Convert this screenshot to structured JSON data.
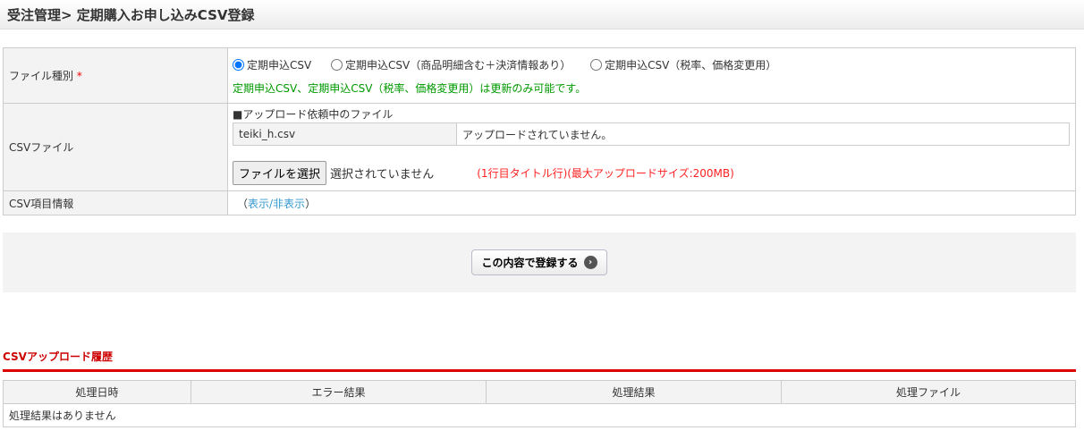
{
  "header": {
    "title": "受注管理> 定期購入お申し込みCSV登録"
  },
  "form": {
    "file_type": {
      "label": "ファイル種別",
      "required": "*",
      "options": [
        "定期申込CSV",
        "定期申込CSV（商品明細含む＋決済情報あり）",
        "定期申込CSV（税率、価格変更用）"
      ],
      "selected": 0,
      "note": "定期申込CSV、定期申込CSV（税率、価格変更用）は更新のみ可能です。"
    },
    "csv_file": {
      "label": "CSVファイル",
      "pending_title": "■アップロード依頼中のファイル",
      "pending_file": "teiki_h.csv",
      "pending_status": "アップロードされていません。",
      "choose_button": "ファイルを選択",
      "no_file": "選択されていません",
      "hint": "(1行目タイトル行)(最大アップロードサイズ:200MB)"
    },
    "csv_info": {
      "label": "CSV項目情報",
      "open": "（",
      "link": "表示/非表示",
      "close": "）"
    }
  },
  "submit": {
    "label": "この内容で登録する",
    "icon": "arrow-right-icon"
  },
  "history": {
    "title": "CSVアップロード履歴",
    "columns": [
      "処理日時",
      "エラー結果",
      "処理結果",
      "処理ファイル"
    ],
    "empty": "処理結果はありません"
  }
}
